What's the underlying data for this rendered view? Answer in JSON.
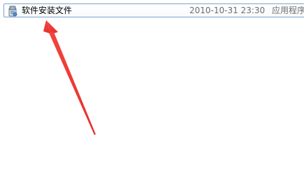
{
  "file": {
    "name": "软件安装文件",
    "modified": "2010-10-31 23:30",
    "type": "应用程序",
    "icon": "installer-package-icon"
  },
  "annotation": {
    "icon": "red-arrow-annotation",
    "color": "#e8302c"
  }
}
